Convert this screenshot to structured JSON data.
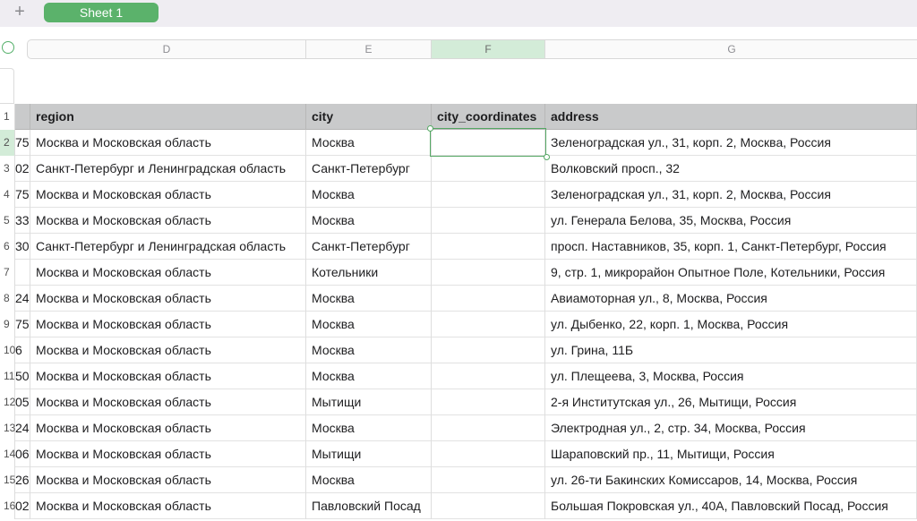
{
  "tabs": {
    "add_label": "+",
    "active_sheet": "Sheet 1"
  },
  "columns": [
    {
      "letter": "D",
      "selected": false
    },
    {
      "letter": "E",
      "selected": false
    },
    {
      "letter": "F",
      "selected": true
    },
    {
      "letter": "G",
      "selected": false
    }
  ],
  "header_row": {
    "num": "1",
    "c_cut": "",
    "region": "region",
    "city": "city",
    "coords": "city_coordinates",
    "address": "address"
  },
  "rows": [
    {
      "num": "2",
      "c": "75",
      "region": "Москва и Московская область",
      "city": "Москва",
      "coords": "",
      "address": "Зеленоградская ул., 31, корп. 2, Москва, Россия"
    },
    {
      "num": "3",
      "c": "02",
      "region": "Санкт-Петербург и Ленинградская область",
      "city": "Санкт-Петербург",
      "coords": "",
      "address": "Волковский просп., 32"
    },
    {
      "num": "4",
      "c": "75",
      "region": "Москва и Московская область",
      "city": "Москва",
      "coords": "",
      "address": "Зеленоградская ул., 31, корп. 2, Москва, Россия"
    },
    {
      "num": "5",
      "c": "33",
      "region": "Москва и Московская область",
      "city": "Москва",
      "coords": "",
      "address": "ул. Генерала Белова, 35, Москва, Россия"
    },
    {
      "num": "6",
      "c": "30",
      "region": "Санкт-Петербург и Ленинградская область",
      "city": "Санкт-Петербург",
      "coords": "",
      "address": "просп. Наставников, 35, корп. 1, Санкт-Петербург, Россия"
    },
    {
      "num": "7",
      "c": "",
      "region": "Москва и Московская область",
      "city": "Котельники",
      "coords": "",
      "address": "9, стр. 1, микрорайон Опытное Поле, Котельники, Россия"
    },
    {
      "num": "8",
      "c": "24",
      "region": "Москва и Московская область",
      "city": "Москва",
      "coords": "",
      "address": "Авиамоторная ул., 8, Москва, Россия"
    },
    {
      "num": "9",
      "c": "75",
      "region": "Москва и Московская область",
      "city": "Москва",
      "coords": "",
      "address": "ул. Дыбенко, 22, корп. 1, Москва, Россия"
    },
    {
      "num": "10",
      "c": "6",
      "region": "Москва и Московская область",
      "city": "Москва",
      "coords": "",
      "address": "ул. Грина, 11Б"
    },
    {
      "num": "11",
      "c": "50",
      "region": "Москва и Московская область",
      "city": "Москва",
      "coords": "",
      "address": "ул. Плещеева, 3, Москва, Россия"
    },
    {
      "num": "12",
      "c": "05",
      "region": "Москва и Московская область",
      "city": "Мытищи",
      "coords": "",
      "address": "2-я Институтская ул., 26, Мытищи, Россия"
    },
    {
      "num": "13",
      "c": "24",
      "region": "Москва и Московская область",
      "city": "Москва",
      "coords": "",
      "address": "Электродная ул., 2, стр. 34, Москва, Россия"
    },
    {
      "num": "14",
      "c": "06",
      "region": "Москва и Московская область",
      "city": "Мытищи",
      "coords": "",
      "address": "Шараповский пр., 11, Мытищи, Россия"
    },
    {
      "num": "15",
      "c": "26",
      "region": "Москва и Московская область",
      "city": "Москва",
      "coords": "",
      "address": "ул. 26-ти Бакинских Комиссаров, 14, Москва, Россия"
    },
    {
      "num": "16",
      "c": "02",
      "region": "Москва и Московская область",
      "city": "Павловский Посад",
      "coords": "",
      "address": "Большая Покровская ул., 40А, Павловский Посад, Россия"
    }
  ],
  "selected_row": "2",
  "colors": {
    "accent": "#5bb26b",
    "selection": "#d3ecd8",
    "header_row_bg": "#c9cacb"
  }
}
